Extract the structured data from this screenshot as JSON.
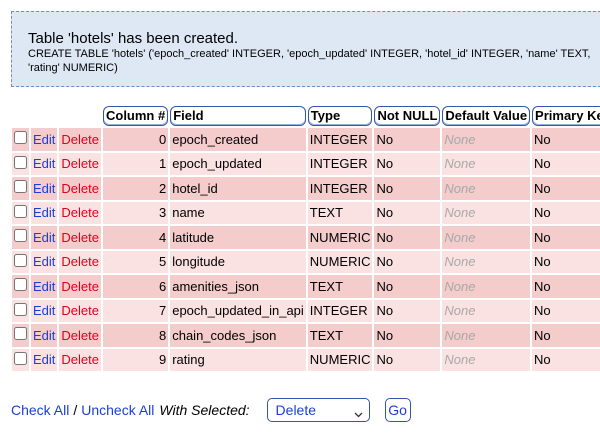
{
  "notice": {
    "title": "Table 'hotels' has been created.",
    "sql_line1": "CREATE TABLE 'hotels' ('epoch_created' INTEGER, 'epoch_updated' INTEGER, 'hotel_id' INTEGER, 'name' TEXT,",
    "sql_line2": "'rating' NUMERIC)"
  },
  "table": {
    "headers": {
      "column_num": "Column #",
      "field": "Field",
      "type": "Type",
      "not_null": "Not NULL",
      "default_value": "Default Value",
      "primary_key": "Primary Key"
    },
    "rows": [
      {
        "edit": "Edit",
        "delete": "Delete",
        "num": "0",
        "field": "epoch_created",
        "type": "INTEGER",
        "not_null": "No",
        "default": "None",
        "pk": "No"
      },
      {
        "edit": "Edit",
        "delete": "Delete",
        "num": "1",
        "field": "epoch_updated",
        "type": "INTEGER",
        "not_null": "No",
        "default": "None",
        "pk": "No"
      },
      {
        "edit": "Edit",
        "delete": "Delete",
        "num": "2",
        "field": "hotel_id",
        "type": "INTEGER",
        "not_null": "No",
        "default": "None",
        "pk": "No"
      },
      {
        "edit": "Edit",
        "delete": "Delete",
        "num": "3",
        "field": "name",
        "type": "TEXT",
        "not_null": "No",
        "default": "None",
        "pk": "No"
      },
      {
        "edit": "Edit",
        "delete": "Delete",
        "num": "4",
        "field": "latitude",
        "type": "NUMERIC",
        "not_null": "No",
        "default": "None",
        "pk": "No"
      },
      {
        "edit": "Edit",
        "delete": "Delete",
        "num": "5",
        "field": "longitude",
        "type": "NUMERIC",
        "not_null": "No",
        "default": "None",
        "pk": "No"
      },
      {
        "edit": "Edit",
        "delete": "Delete",
        "num": "6",
        "field": "amenities_json",
        "type": "TEXT",
        "not_null": "No",
        "default": "None",
        "pk": "No"
      },
      {
        "edit": "Edit",
        "delete": "Delete",
        "num": "7",
        "field": "epoch_updated_in_api",
        "type": "INTEGER",
        "not_null": "No",
        "default": "None",
        "pk": "No"
      },
      {
        "edit": "Edit",
        "delete": "Delete",
        "num": "8",
        "field": "chain_codes_json",
        "type": "TEXT",
        "not_null": "No",
        "default": "None",
        "pk": "No"
      },
      {
        "edit": "Edit",
        "delete": "Delete",
        "num": "9",
        "field": "rating",
        "type": "NUMERIC",
        "not_null": "No",
        "default": "None",
        "pk": "No"
      }
    ]
  },
  "footer": {
    "check_all": "Check All",
    "separator": "/",
    "uncheck_all": "Uncheck All",
    "with_selected": "With Selected:",
    "action_selected": "Delete",
    "go_label": "Go"
  },
  "colors": {
    "row_odd": "#f4cccc",
    "row_even": "#fbe2e2",
    "link_blue": "#1a3fd6",
    "delete_red": "#e0001b",
    "notice_bg": "#dde8f4"
  },
  "icons": {
    "select_arrow": "chevron-down-icon"
  }
}
